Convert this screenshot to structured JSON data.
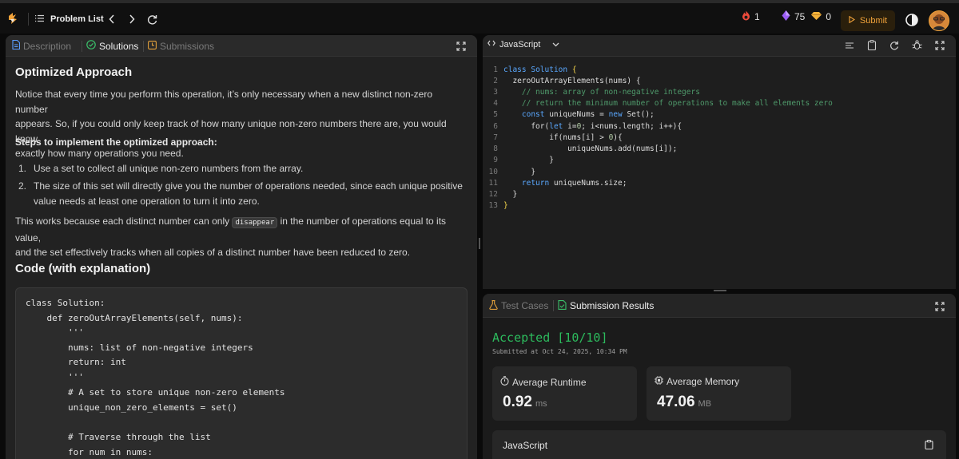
{
  "topbar": {
    "problem_list": "Problem List",
    "streak": "1",
    "gems": "75",
    "coins": "0",
    "submit": "Submit"
  },
  "left_tabs": {
    "description": "Description",
    "solutions": "Solutions",
    "submissions": "Submissions"
  },
  "article": {
    "heading": "Optimized Approach",
    "para1_l1": "Notice that every time you perform this operation, it’s only necessary when a new distinct non-zero number",
    "para1_l2": "appears. So, if you could only keep track of how many unique non-zero numbers there are, you would know",
    "para1_l3": "exactly how many operations you need.",
    "steps_label": "Steps to implement the optimized approach:",
    "step1_num": "1.",
    "step1": "Use a set to collect all unique non-zero numbers from the array.",
    "step2_num": "2.",
    "step2_l1": "The size of this set will directly give you the number of operations needed, since each unique positive",
    "step2_l2": "value needs at least one operation to turn it into zero.",
    "para2_pre": "This works because each distinct number can only ",
    "para2_code": "disappear",
    "para2_post": " in the number of operations equal to its value,",
    "para2_l2": "and the set effectively tracks when all copies of a distinct number have been reduced to zero.",
    "code_heading": "Code (with explanation)",
    "code_lines": [
      "class Solution:",
      "    def zeroOutArrayElements(self, nums):",
      "        '''",
      "        nums: list of non-negative integers",
      "        return: int",
      "        '''",
      "        # A set to store unique non-zero elements",
      "        unique_non_zero_elements = set()",
      "",
      "        # Traverse through the list",
      "        for num in nums:"
    ]
  },
  "editor": {
    "language": "JavaScript",
    "line_numbers": [
      "1",
      "2",
      "3",
      "4",
      "5",
      "6",
      "7",
      "8",
      "9",
      "10",
      "11",
      "12",
      "13"
    ],
    "lines": {
      "l1_kw": "class",
      "l1_name": "Solution",
      "l1_brace": "{",
      "l2": "  zeroOutArrayElements(nums) {",
      "l3": "    // nums: array of non-negative integers",
      "l4": "    // return the minimum number of operations to make all elements zero",
      "l5_kw": "    const",
      "l5_rest": " uniqueNums = ",
      "l5_new": "new",
      "l5_end": " Set();",
      "l6_kw": "      for",
      "l6_let": "let",
      "l6_a": "(",
      "l6_b": " i=",
      "l6_zero": "0",
      "l6_c": "; i<nums.length; i++){",
      "l7_kw": "          if",
      "l7_a": "(nums[i] > ",
      "l7_zero": "0",
      "l7_b": "){",
      "l8": "              uniqueNums.add(nums[i]);",
      "l9": "          }",
      "l10": "      }",
      "l11_kw": "    return",
      "l11_rest": " uniqueNums.size;",
      "l12": "  }",
      "l13": "}"
    }
  },
  "results": {
    "test_cases": "Test Cases",
    "submission_results": "Submission Results",
    "status": "Accepted [10/10]",
    "submitted_at": "Submitted at Oct 24, 2025, 10:34 PM",
    "runtime_label": "Average Runtime",
    "runtime_value": "0.92",
    "runtime_unit": "ms",
    "memory_label": "Average Memory",
    "memory_value": "47.06",
    "memory_unit": "MB",
    "language": "JavaScript"
  },
  "colors": {
    "accent": "#f2a33a",
    "accepted": "#2cbb5d",
    "keyword": "#5aa8ff",
    "comment": "#4f9a6b"
  }
}
